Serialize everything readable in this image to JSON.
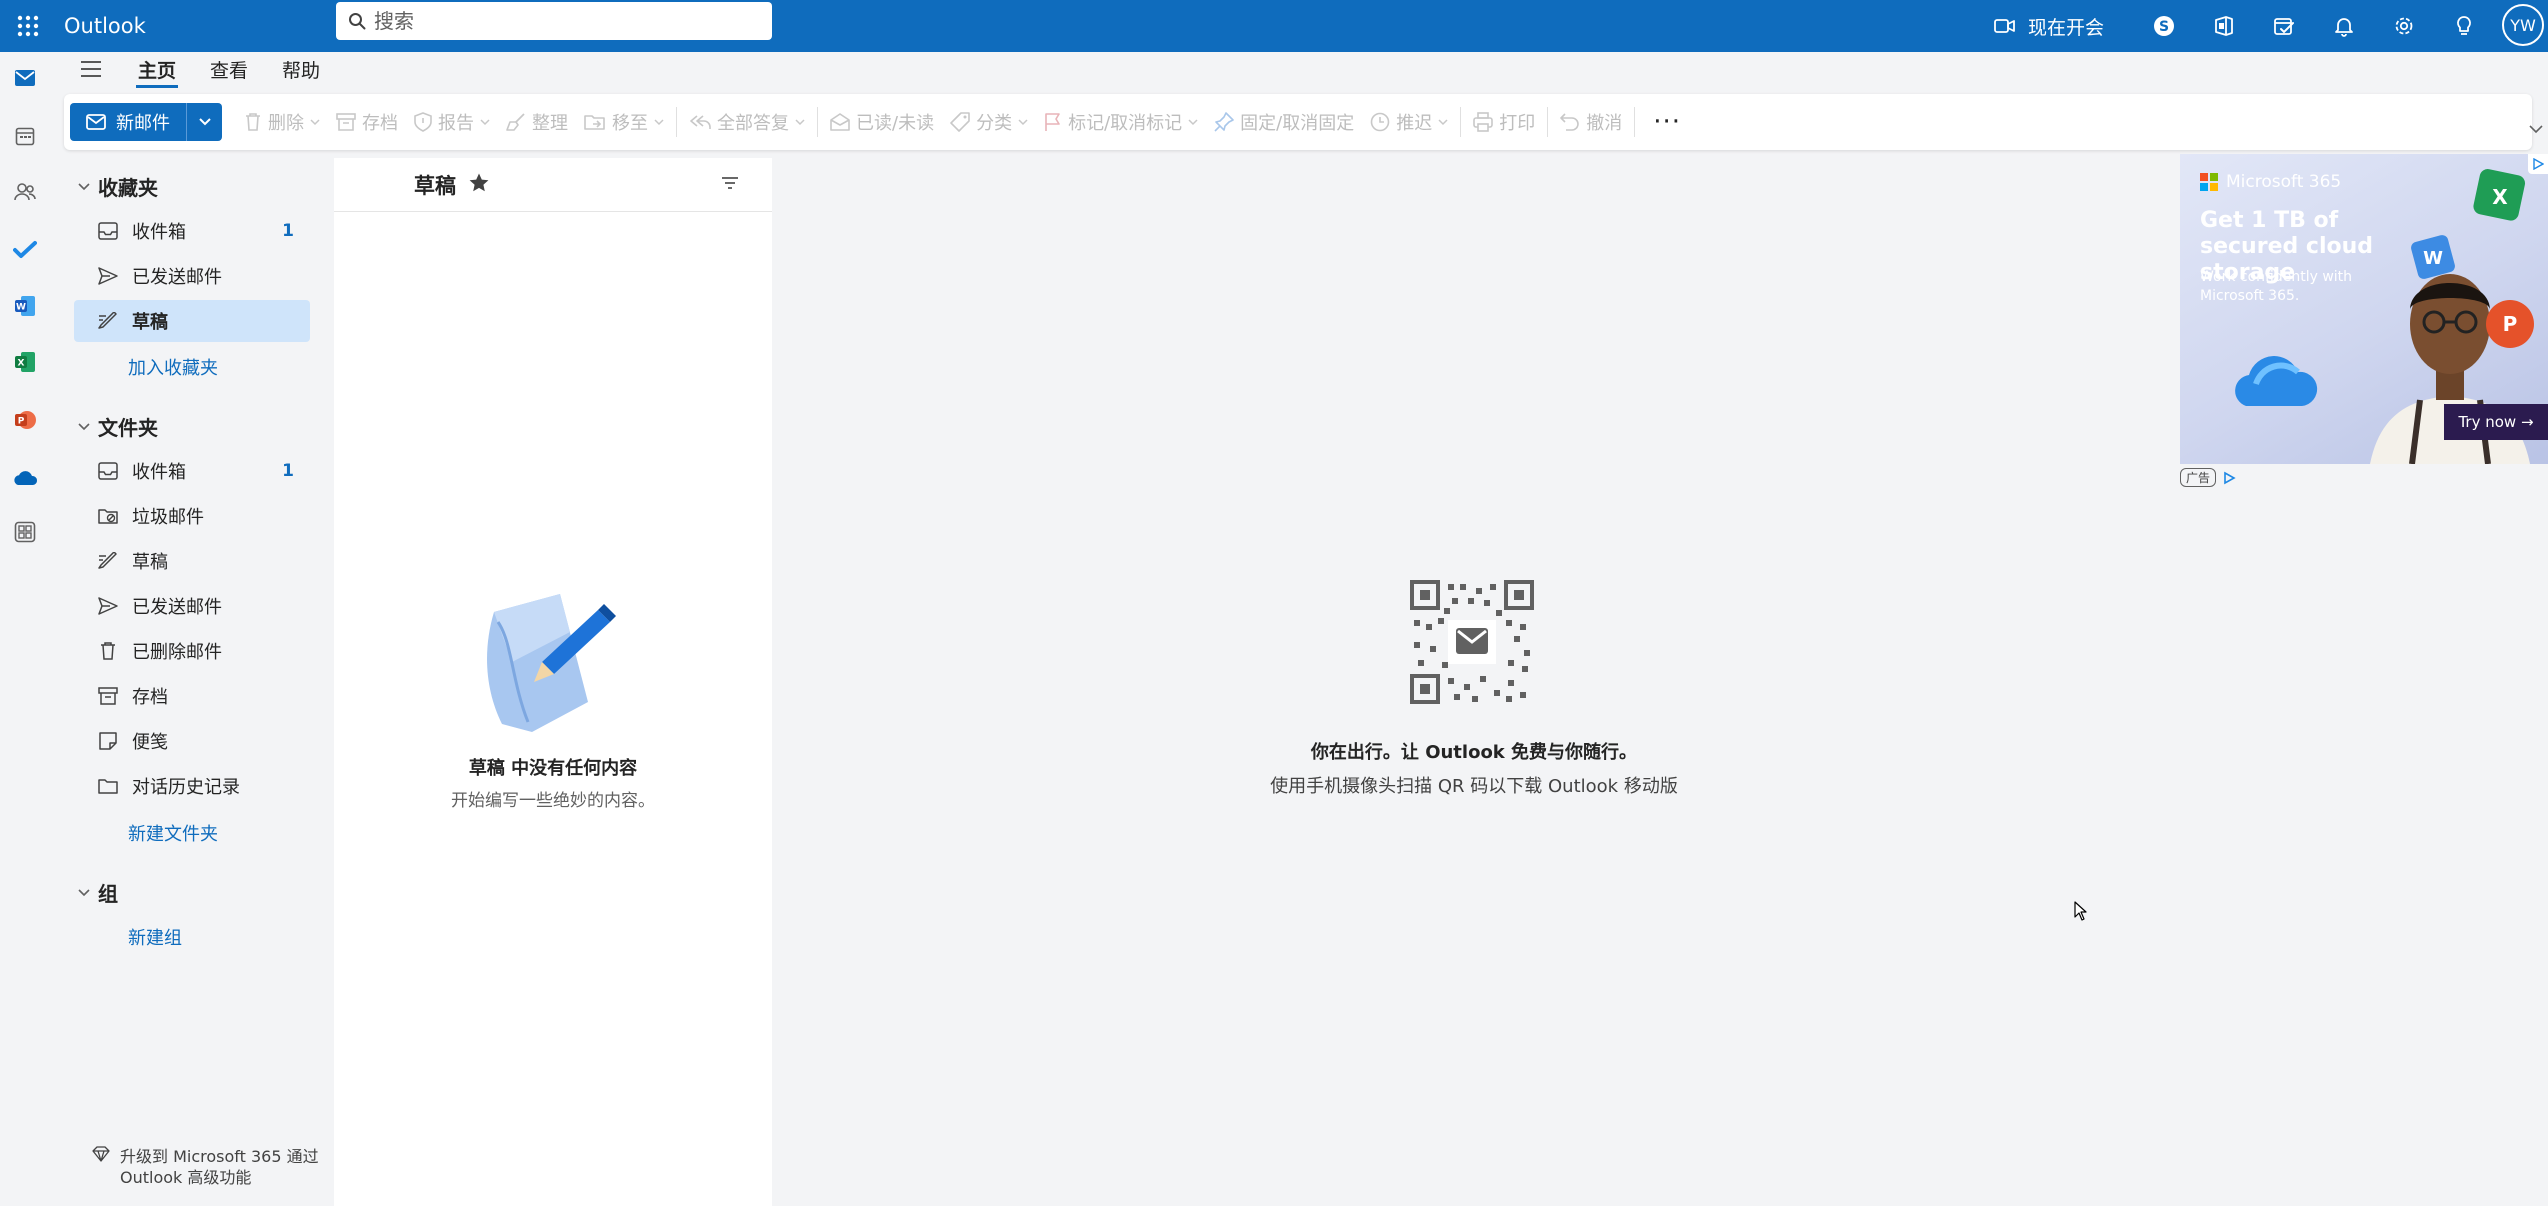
{
  "topbar": {
    "app_name": "Outlook",
    "search_placeholder": "搜索",
    "meet_now": "现在开会",
    "avatar_initials": "YW"
  },
  "ribbon": {
    "tabs": [
      {
        "label": "主页",
        "active": true
      },
      {
        "label": "查看",
        "active": false
      },
      {
        "label": "帮助",
        "active": false
      }
    ]
  },
  "commands": {
    "new_mail": "新邮件",
    "delete": "删除",
    "archive": "存档",
    "report": "报告",
    "sweep": "整理",
    "move_to": "移至",
    "reply_all": "全部答复",
    "read_unread": "已读/未读",
    "categorize": "分类",
    "flag": "标记/取消标记",
    "pin": "固定/取消固定",
    "snooze": "推迟",
    "print": "打印",
    "undo": "撤消",
    "more": "···"
  },
  "nav": {
    "favorites": {
      "header": "收藏夹",
      "items": [
        {
          "label": "收件箱",
          "count": "1",
          "icon": "inbox-icon"
        },
        {
          "label": "已发送邮件",
          "count": "",
          "icon": "send-icon"
        },
        {
          "label": "草稿",
          "count": "",
          "icon": "draft-icon",
          "selected": true
        }
      ],
      "add_link": "加入收藏夹"
    },
    "folders": {
      "header": "文件夹",
      "items": [
        {
          "label": "收件箱",
          "count": "1",
          "icon": "inbox-icon"
        },
        {
          "label": "垃圾邮件",
          "count": "",
          "icon": "junk-icon"
        },
        {
          "label": "草稿",
          "count": "",
          "icon": "draft-icon"
        },
        {
          "label": "已发送邮件",
          "count": "",
          "icon": "send-icon"
        },
        {
          "label": "已删除邮件",
          "count": "",
          "icon": "trash-icon"
        },
        {
          "label": "存档",
          "count": "",
          "icon": "archive-icon"
        },
        {
          "label": "便笺",
          "count": "",
          "icon": "note-icon"
        },
        {
          "label": "对话历史记录",
          "count": "",
          "icon": "folder-icon"
        }
      ],
      "new_link": "新建文件夹"
    },
    "groups": {
      "header": "组",
      "new_link": "新建组"
    },
    "upgrade": "升级到 Microsoft 365 通过 Outlook 高级功能"
  },
  "message_list": {
    "title": "草稿",
    "empty_title": "草稿 中没有任何内容",
    "empty_subtitle": "开始编写一些绝妙的内容。"
  },
  "reading_pane": {
    "promo_title": "你在出行。让 Outlook 免费与你随行。",
    "promo_subtitle": "使用手机摄像头扫描 QR 码以下载 Outlook 移动版"
  },
  "ad": {
    "brand": "Microsoft 365",
    "headline": "Get 1 TB of secured cloud storage",
    "sub": "Work confidently with Microsoft 365.",
    "cta": "Try now →",
    "label": "广告"
  },
  "colors": {
    "brand": "#0f6cbd",
    "selected": "#cfe4fa"
  }
}
